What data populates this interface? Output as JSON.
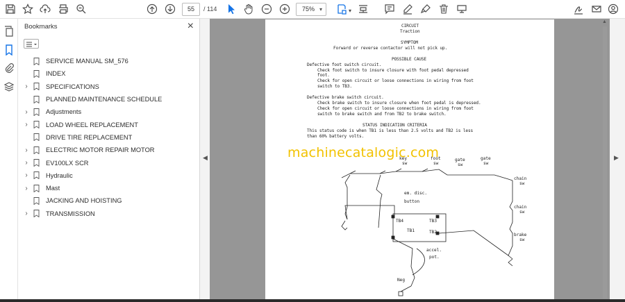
{
  "toolbar": {
    "page_current": "55",
    "page_total": "/ 114",
    "zoom": "75%"
  },
  "bookmarks": {
    "title": "Bookmarks",
    "items": [
      {
        "label": "SERVICE MANUAL SM_576",
        "expandable": false
      },
      {
        "label": "INDEX",
        "expandable": false
      },
      {
        "label": "SPECIFICATIONS",
        "expandable": true
      },
      {
        "label": "PLANNED MAINTENANCE SCHEDULE",
        "expandable": false
      },
      {
        "label": "Adjustments",
        "expandable": true
      },
      {
        "label": "LOAD WHEEL REPLACEMENT",
        "expandable": true
      },
      {
        "label": "DRIVE TIRE REPLACEMENT",
        "expandable": false
      },
      {
        "label": "ELECTRIC MOTOR REPAIR MOTOR",
        "expandable": true
      },
      {
        "label": "EV100LX SCR",
        "expandable": true
      },
      {
        "label": "Hydraulic",
        "expandable": true
      },
      {
        "label": "Mast",
        "expandable": true
      },
      {
        "label": "JACKING AND HOISTING",
        "expandable": false
      },
      {
        "label": "TRANSMISSION",
        "expandable": true
      }
    ]
  },
  "document": {
    "heading1": "CIRCUIT",
    "heading2": "Traction",
    "symptom_title": "SYMPTOM",
    "symptom_text": "Forward or reverse contactor will not pick up.",
    "cause_title": "POSSIBLE CAUSE",
    "cause1_title": "Defective foot switch circuit.",
    "cause1_line1": "Check foot switch to insure closure with foot pedal depressed",
    "cause1_line2": "foot.",
    "cause1_line3": "Check for open circuit or loose connections in wiring from foot",
    "cause1_line4": "switch to TB3.",
    "cause2_title": "Defective brake switch circuit.",
    "cause2_line1": "Check brake switch to insure closure when foot pedal is depressed.",
    "cause2_line2": "Check for open circuit or loose connections in wiring from foot",
    "cause2_line3": "switch to brake switch and from TB2 to brake switch.",
    "status_title": "STATUS INDICATION CRITERIA",
    "status_line1": "This status code is when TB1 is less than 2.5 volts and TB2 is less",
    "status_line2": "than 60% battery volts.",
    "watermark": "machinecatalogic.com",
    "diagram": {
      "key_sw": "key",
      "foot_sw": "foot",
      "gate1_sw": "gate",
      "gate2_sw": "gate",
      "sw_label": "sw",
      "chain1": "chain",
      "chain2": "chain",
      "brake": "brake",
      "em_disc": "em. disc.",
      "button": "button",
      "tb4": "TB4",
      "tb3": "TB3",
      "tb1": "TB1",
      "tb2": "TB2",
      "accel": "accel.",
      "pot": "pot.",
      "neg": "Neg"
    }
  }
}
